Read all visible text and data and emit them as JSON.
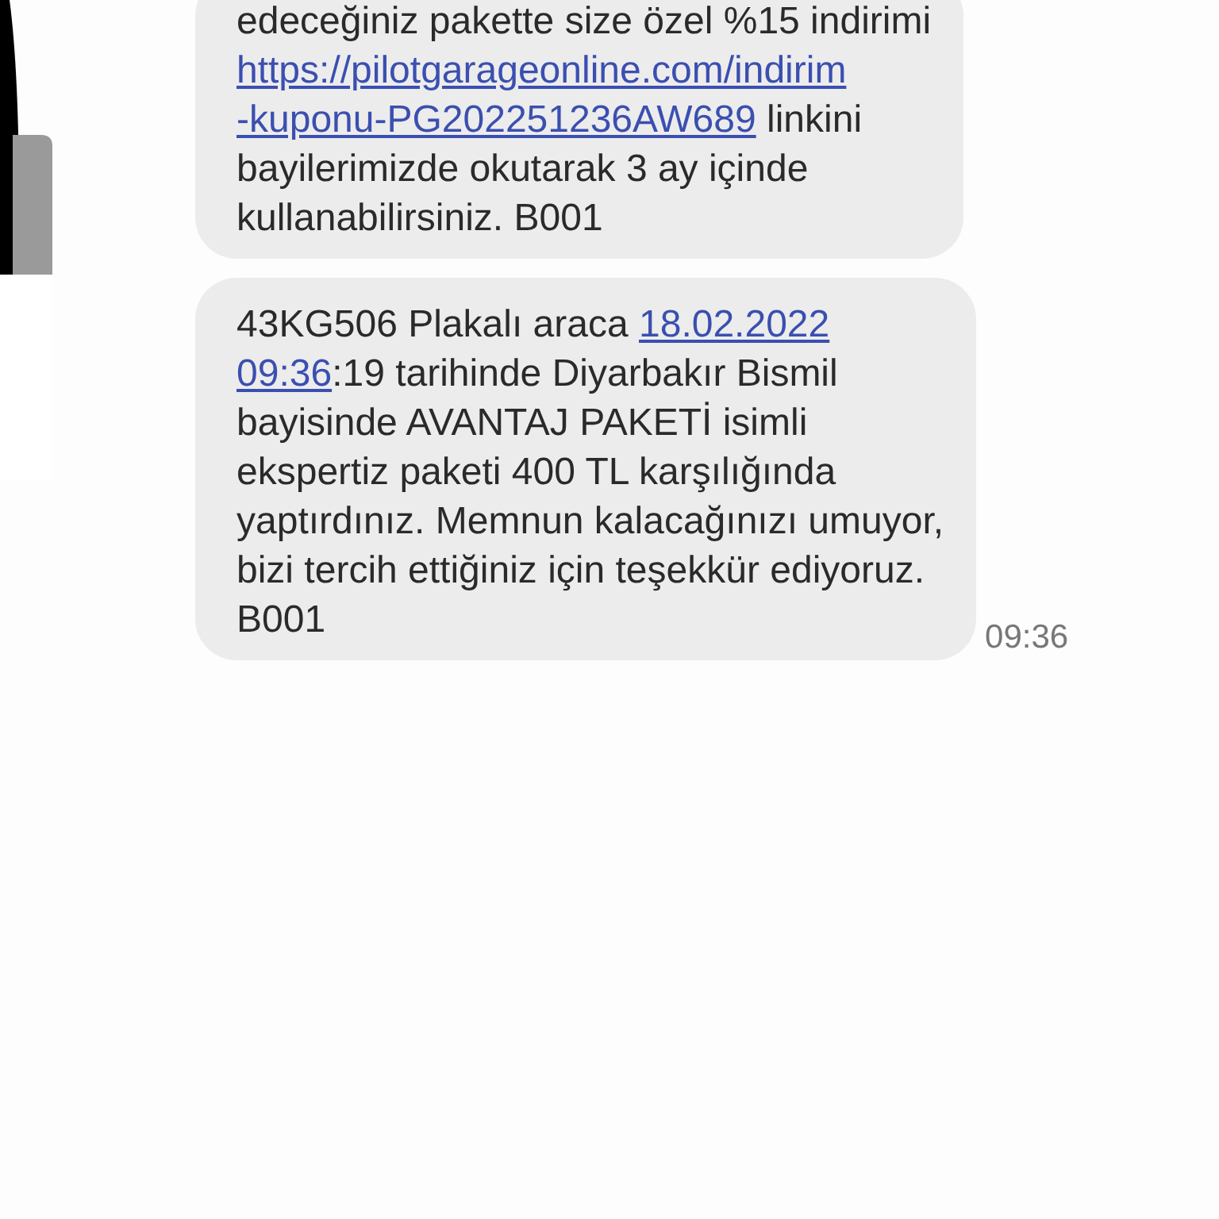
{
  "messages": [
    {
      "lines": [
        [
          {
            "kind": "text",
            "text": "edeceğiniz pakette size özel %15 indirimi"
          }
        ],
        [
          {
            "kind": "link",
            "text": "https://pilotgarageonline.com/indirim"
          }
        ],
        [
          {
            "kind": "link",
            "text": "-kuponu-PG202251236AW689"
          },
          {
            "kind": "text",
            "text": " linkini"
          }
        ],
        [
          {
            "kind": "text",
            "text": "bayilerimizde okutarak 3 ay içinde"
          }
        ],
        [
          {
            "kind": "text",
            "text": "kullanabilirsiniz. B001"
          }
        ]
      ]
    },
    {
      "lines": [
        [
          {
            "kind": "text",
            "text": "43KG506 Plakalı araca "
          },
          {
            "kind": "link",
            "text": "18.02.2022"
          }
        ],
        [
          {
            "kind": "link",
            "text": "09:36"
          },
          {
            "kind": "text",
            "text": ":19 tarihinde Diyarbakır Bismil"
          }
        ],
        [
          {
            "kind": "text",
            "text": "bayisinde AVANTAJ PAKETİ isimli"
          }
        ],
        [
          {
            "kind": "text",
            "text": "ekspertiz paketi 400 TL karşılığında"
          }
        ],
        [
          {
            "kind": "text",
            "text": "yaptırdınız. Memnun kalacağınızı umuyor,"
          }
        ],
        [
          {
            "kind": "text",
            "text": "bizi tercih ettiğiniz için teşekkür ediyoruz."
          }
        ],
        [
          {
            "kind": "text",
            "text": "B001"
          }
        ]
      ],
      "time": "09:36"
    }
  ]
}
